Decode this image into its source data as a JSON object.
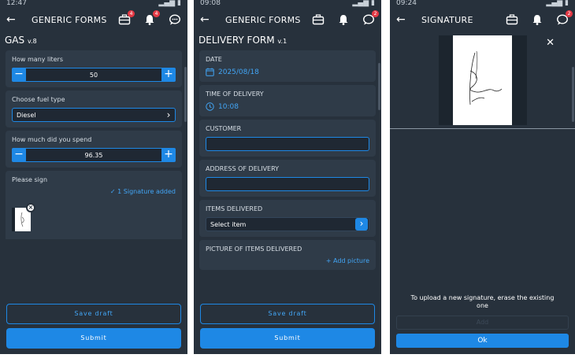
{
  "app_title": "GENERIC FORMS",
  "colors": {
    "bg": "#27313c",
    "card": "#2f3b48",
    "accent": "#1e88e5",
    "badge": "#e53945"
  },
  "screen1": {
    "status_time": "12:47",
    "form_name": "GAS",
    "form_version": "v.8",
    "liters_label": "How many liters",
    "liters_value": "50",
    "fuel_label": "Choose fuel type",
    "fuel_value": "Diesel",
    "spend_label": "How much did you spend",
    "spend_value": "96.35",
    "sign_label": "Please sign",
    "signature_added": "✓ 1 Signature added",
    "save_draft": "Save draft",
    "submit": "Submit"
  },
  "screen2": {
    "status_time": "09:08",
    "form_name": "DELIVERY FORM",
    "form_version": "v.1",
    "date_label": "DATE",
    "date_value": "2025/08/18",
    "time_label": "TIME OF DELIVERY",
    "time_value": "10:08",
    "customer_label": "CUSTOMER",
    "address_label": "ADDRESS OF DELIVERY",
    "items_label": "ITEMS DELIVERED",
    "items_placeholder": "Select item",
    "picture_label": "PICTURE OF ITEMS DELIVERED",
    "add_picture": "+ Add picture",
    "save_draft": "Save draft",
    "submit": "Submit"
  },
  "screen3": {
    "status_time": "09:24",
    "title": "SIGNATURE",
    "upload_message": "To upload a new signature, erase the existing one",
    "erase": "Add",
    "ok": "Ok"
  },
  "icons": [
    "back-arrow-icon",
    "briefcase-icon",
    "bell-icon",
    "chat-icon",
    "calendar-icon",
    "clock-icon",
    "close-icon",
    "chevron-right-icon",
    "minus-icon",
    "plus-icon"
  ]
}
